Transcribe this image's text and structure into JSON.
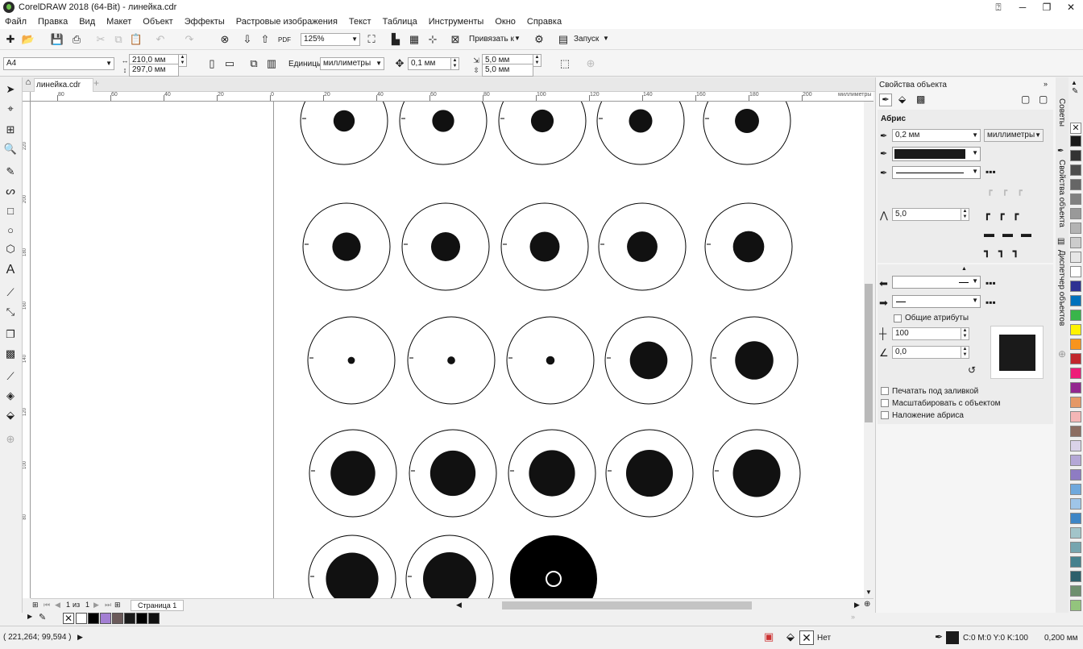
{
  "window": {
    "title": "CorelDRAW 2018 (64-Bit) - линейка.cdr"
  },
  "menu": [
    "Файл",
    "Правка",
    "Вид",
    "Макет",
    "Объект",
    "Эффекты",
    "Растровые изображения",
    "Текст",
    "Таблица",
    "Инструменты",
    "Окно",
    "Справка"
  ],
  "toolbar": {
    "zoom": "125%",
    "snap_label": "Привязать к",
    "launch_label": "Запуск",
    "pdf_label": "PDF"
  },
  "property_bar": {
    "page_size": "A4",
    "width": "210,0 мм",
    "height": "297,0 мм",
    "units_label": "Единицы:",
    "units_value": "миллиметры",
    "nudge": "0,1 мм",
    "dup_x": "5,0 мм",
    "dup_y": "5,0 мм"
  },
  "document": {
    "tab": "линейка.cdr"
  },
  "ruler": {
    "h_ticks": [
      "80",
      "60",
      "40",
      "20",
      "0",
      "20",
      "40",
      "60",
      "80",
      "100",
      "120",
      "140",
      "160",
      "180",
      "200"
    ],
    "h_unit": "миллиметры",
    "v_ticks": [
      "220",
      "200",
      "180",
      "160",
      "140",
      "120",
      "100",
      "80"
    ]
  },
  "pages": {
    "current": "1",
    "of_label": "из",
    "total": "1",
    "page_tab": "Страница 1"
  },
  "status": {
    "coords": "( 221,264; 99,594 )",
    "fill_none": "Нет",
    "outline_color": "C:0 M:0 Y:0 K:100",
    "outline_width": "0,200 мм"
  },
  "object_properties": {
    "title": "Свойства объекта",
    "section": "Абрис",
    "width": "0,2 мм",
    "units": "миллиметры",
    "miter_limit": "5,0",
    "common_attrs": "Общие атрибуты",
    "stretch": "100",
    "angle": "0,0",
    "print_under_fill": "Печатать под заливкой",
    "scale_with_object": "Масштабировать с объектом",
    "overprint_outline": "Наложение абриса"
  },
  "side_tabs": [
    "Советы",
    "Свойства объекта",
    "Диспетчер объектов"
  ],
  "canvas": {
    "rows": [
      {
        "dots": [
          0.3,
          0.31,
          0.32,
          0.33,
          0.34
        ]
      },
      {
        "dots": [
          0.4,
          0.41,
          0.42,
          0.43,
          0.44
        ]
      },
      {
        "dots": [
          0.1,
          0.11,
          0.12,
          0.53,
          0.54
        ]
      },
      {
        "dots": [
          0.63,
          0.64,
          0.65,
          0.66,
          0.67
        ]
      },
      {
        "dots": [
          0.74,
          0.75,
          1.0
        ]
      }
    ]
  },
  "palette_colors": [
    "#1a1a1a",
    "#333333",
    "#4d4d4d",
    "#666666",
    "#808080",
    "#999999",
    "#b3b3b3",
    "#cccccc",
    "#e6e6e6",
    "#ffffff",
    "#2e3192",
    "#0071bc",
    "#39b54a",
    "#fff200",
    "#f7941d",
    "#c1272d",
    "#ed1e79",
    "#93278f",
    "#e59866",
    "#f4b6b6",
    "#8c6d62",
    "#d9d2e9",
    "#b4a7d6",
    "#8e7cc3",
    "#6fa8dc",
    "#9fc5e8",
    "#3d85c6",
    "#a2c4c9",
    "#76a5af",
    "#45818e",
    "#2d5f6b",
    "#6e8f6e",
    "#93c47d"
  ],
  "doc_palette": [
    "#ffffff",
    "#000000",
    "#a37fd3",
    "#6b5a5a",
    "#1a1a1a",
    "#000000",
    "#111111"
  ]
}
